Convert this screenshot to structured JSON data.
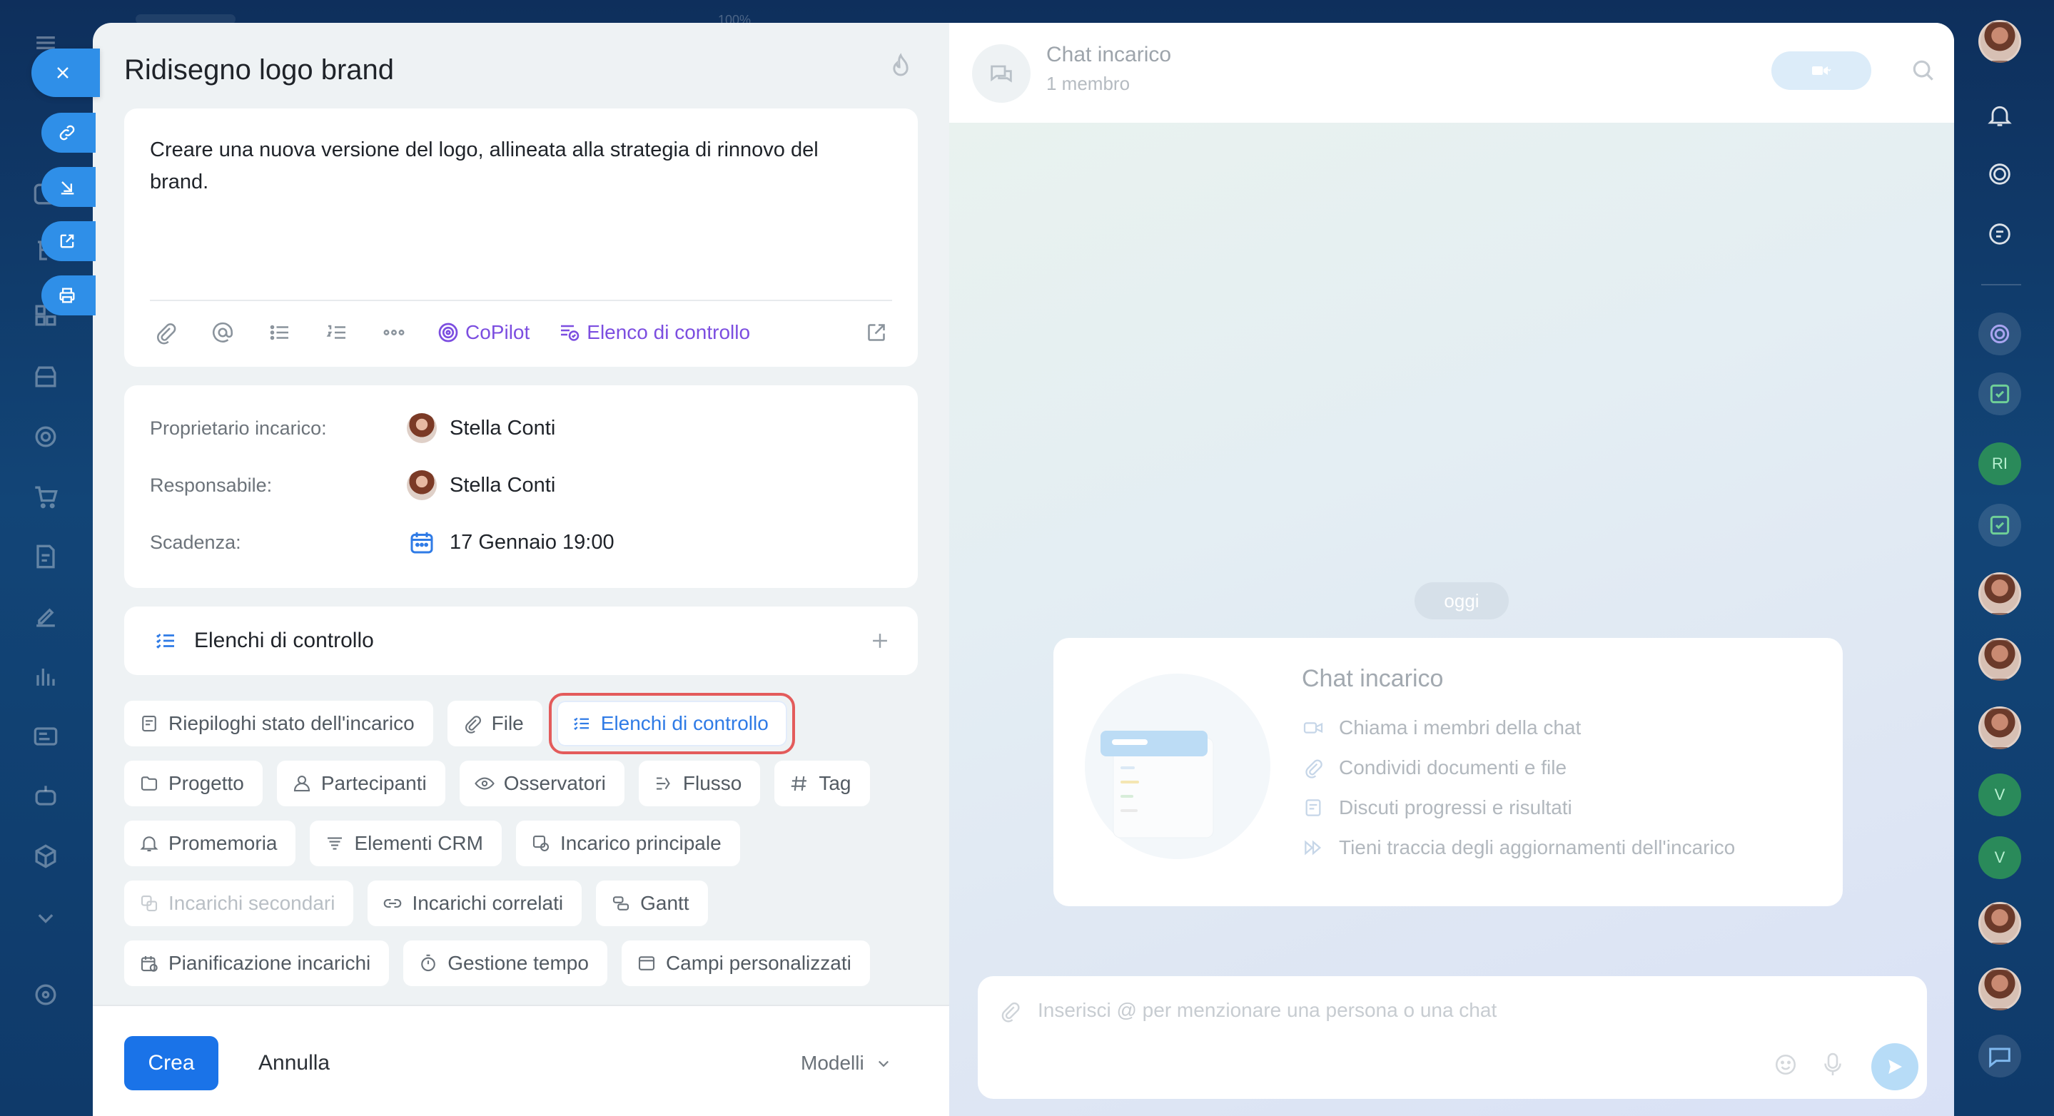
{
  "topbar": {
    "zoom": "100%"
  },
  "task": {
    "title": "Ridisegno logo brand",
    "description": "Creare una nuova versione del logo, allineata alla strategia di rinnovo del brand.",
    "toolbar": {
      "copilot": "CoPilot",
      "checklist_link": "Elenco di controllo"
    }
  },
  "info": {
    "owner_label": "Proprietario incarico:",
    "owner_value": "Stella Conti",
    "responsible_label": "Responsabile:",
    "responsible_value": "Stella Conti",
    "deadline_label": "Scadenza:",
    "deadline_value": "17 Gennaio 19:00"
  },
  "checklist_section": {
    "title": "Elenchi di controllo"
  },
  "chips": {
    "summary": "Riepiloghi stato dell'incarico",
    "file": "File",
    "checklists": "Elenchi di controllo",
    "project": "Progetto",
    "participants": "Partecipanti",
    "observers": "Osservatori",
    "flow": "Flusso",
    "tag": "Tag",
    "reminder": "Promemoria",
    "crm": "Elementi CRM",
    "parent": "Incarico principale",
    "subtasks": "Incarichi secondari",
    "related": "Incarichi correlati",
    "gantt": "Gantt",
    "planning": "Pianificazione incarichi",
    "time": "Gestione tempo",
    "custom": "Campi personalizzati"
  },
  "footer": {
    "create": "Crea",
    "cancel": "Annulla",
    "models": "Modelli"
  },
  "chat": {
    "title": "Chat incarico",
    "members": "1 membro",
    "date_pill": "oggi",
    "welcome_title": "Chat incarico",
    "welcome_items": [
      "Chiama i membri della chat",
      "Condividi documenti e file",
      "Discuti progressi e risultati",
      "Tieni traccia degli aggiornamenti dell'incarico"
    ],
    "composer_placeholder": "Inserisci @ per menzionare una persona o una chat"
  },
  "right_rail": {
    "initials_1": "RI",
    "initials_2": "V",
    "initials_3": "V"
  },
  "colors": {
    "primary": "#1a73e8",
    "copilot": "#7c4ee0",
    "highlight": "#e35b5b"
  }
}
